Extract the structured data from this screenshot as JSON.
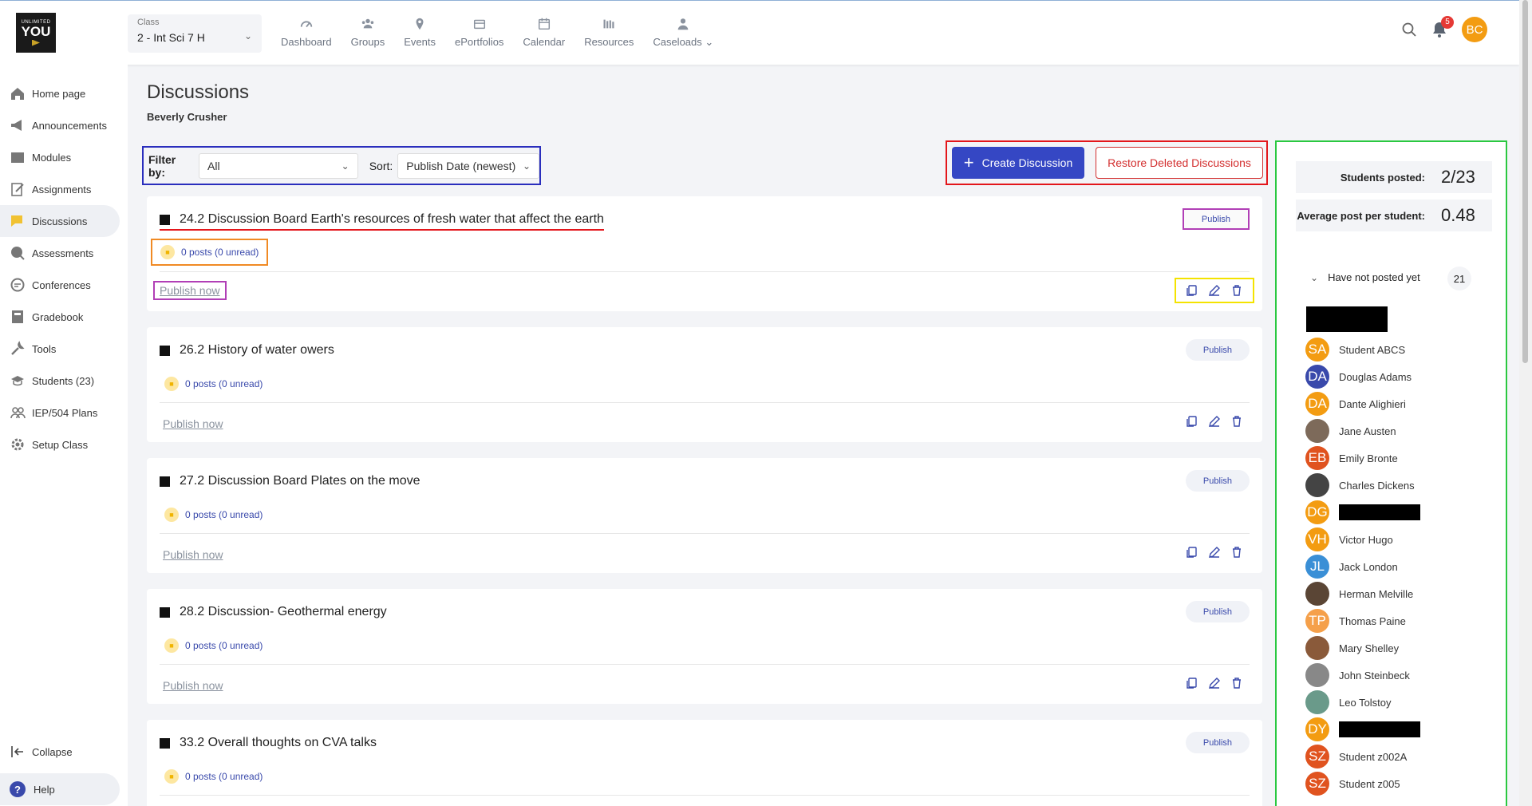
{
  "logo": {
    "line1": "UNLIMITED",
    "line2": "YOU"
  },
  "class_select": {
    "label": "Class",
    "value": "2 - Int Sci 7 H"
  },
  "nav": [
    {
      "label": "Dashboard",
      "icon": "gauge-icon"
    },
    {
      "label": "Groups",
      "icon": "groups-icon"
    },
    {
      "label": "Events",
      "icon": "location-pin-icon"
    },
    {
      "label": "ePortfolios",
      "icon": "portfolio-icon"
    },
    {
      "label": "Calendar",
      "icon": "calendar-icon"
    },
    {
      "label": "Resources",
      "icon": "resources-icon"
    },
    {
      "label": "Caseloads ⌄",
      "icon": "person-icon"
    }
  ],
  "top_right": {
    "notifications": "5",
    "user_initials": "BC"
  },
  "sidebar": {
    "items": [
      {
        "label": "Home page",
        "icon": "home-icon"
      },
      {
        "label": "Announcements",
        "icon": "megaphone-icon"
      },
      {
        "label": "Modules",
        "icon": "folder-icon"
      },
      {
        "label": "Assignments",
        "icon": "assignment-icon"
      },
      {
        "label": "Discussions",
        "icon": "chat-icon"
      },
      {
        "label": "Assessments",
        "icon": "assessment-icon"
      },
      {
        "label": "Conferences",
        "icon": "conference-icon"
      },
      {
        "label": "Gradebook",
        "icon": "gradebook-icon"
      },
      {
        "label": "Tools",
        "icon": "tools-icon"
      },
      {
        "label": "Students (23)",
        "icon": "students-icon"
      },
      {
        "label": "IEP/504 Plans",
        "icon": "plans-icon"
      },
      {
        "label": "Setup Class",
        "icon": "setup-icon"
      }
    ],
    "collapse": "Collapse",
    "help": "Help"
  },
  "page": {
    "title": "Discussions",
    "subtitle": "Beverly Crusher"
  },
  "filter": {
    "filter_label": "Filter by:",
    "filter_value": "All",
    "sort_label": "Sort:",
    "sort_value": "Publish Date (newest)"
  },
  "actions": {
    "create": "Create Discussion",
    "restore": "Restore Deleted Discussions"
  },
  "discussions": [
    {
      "title": "24.2 Discussion Board Earth's resources of fresh water that affect the earth",
      "posts": "0 posts (0 unread)",
      "badge": "Publish",
      "publish_now": "Publish now"
    },
    {
      "title": "26.2 History of water owers",
      "posts": "0 posts (0 unread)",
      "badge": "Publish",
      "publish_now": "Publish now"
    },
    {
      "title": "27.2 Discussion Board Plates on the move",
      "posts": "0 posts (0 unread)",
      "badge": "Publish",
      "publish_now": "Publish now"
    },
    {
      "title": "28.2 Discussion- Geothermal energy",
      "posts": "0 posts (0 unread)",
      "badge": "Publish",
      "publish_now": "Publish now"
    },
    {
      "title": "33.2 Overall thoughts on CVA talks",
      "posts": "0 posts (0 unread)",
      "badge": "Publish",
      "publish_now": "Publish now"
    }
  ],
  "stats": {
    "students_posted_label": "Students posted:",
    "students_posted_value": "2/23",
    "avg_label": "Average post per student:",
    "avg_value": "0.48"
  },
  "not_posted": {
    "label": "Have not posted yet",
    "count": "21"
  },
  "students": [
    {
      "initials": "SA",
      "name": "Student ABCS",
      "color": "#f39c12"
    },
    {
      "initials": "DA",
      "name": "Douglas Adams",
      "color": "#3949ab"
    },
    {
      "initials": "DA",
      "name": "Dante Alighieri",
      "color": "#f39c12"
    },
    {
      "initials": "",
      "name": "Jane Austen",
      "color": "#7d6a5a"
    },
    {
      "initials": "EB",
      "name": "Emily Bronte",
      "color": "#e0531f"
    },
    {
      "initials": "",
      "name": "Charles Dickens",
      "color": "#444444"
    },
    {
      "initials": "DG",
      "name": "",
      "color": "#f39c12",
      "redacted": true
    },
    {
      "initials": "VH",
      "name": "Victor Hugo",
      "color": "#f39c12"
    },
    {
      "initials": "JL",
      "name": "Jack London",
      "color": "#3a8fd6"
    },
    {
      "initials": "",
      "name": "Herman Melville",
      "color": "#5a4535"
    },
    {
      "initials": "TP",
      "name": "Thomas Paine",
      "color": "#f5a04a"
    },
    {
      "initials": "",
      "name": "Mary Shelley",
      "color": "#8a5a3a"
    },
    {
      "initials": "",
      "name": "John Steinbeck",
      "color": "#888888"
    },
    {
      "initials": "",
      "name": "Leo Tolstoy",
      "color": "#6a9a8a"
    },
    {
      "initials": "DY",
      "name": "",
      "color": "#f39c12",
      "redacted": true
    },
    {
      "initials": "SZ",
      "name": "Student z002A",
      "color": "#e0531f"
    },
    {
      "initials": "SZ",
      "name": "Student z005",
      "color": "#e0531f"
    }
  ]
}
